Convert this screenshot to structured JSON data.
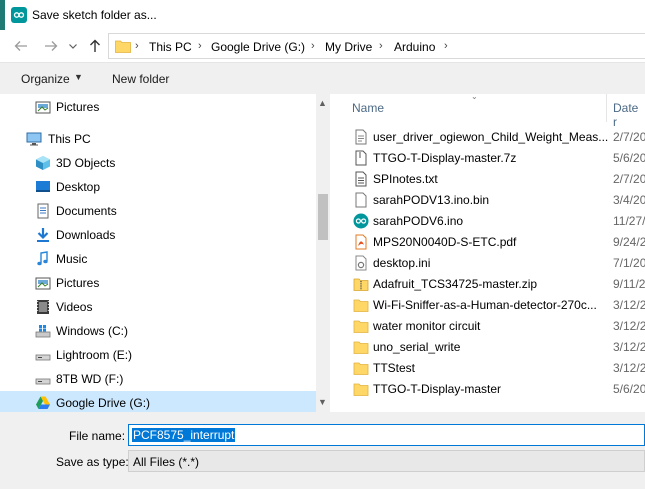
{
  "window": {
    "title": "Save sketch folder as...",
    "accent": "#1f7a74"
  },
  "nav": {
    "back_icon": "arrow-left-icon",
    "forward_icon": "arrow-right-icon",
    "recent_icon": "chevron-down-icon",
    "up_icon": "arrow-up-icon"
  },
  "breadcrumb": [
    "This PC",
    "Google Drive (G:)",
    "My Drive",
    "Arduino"
  ],
  "toolbar": {
    "organize": "Organize",
    "new_folder": "New folder"
  },
  "navpane": {
    "items": [
      {
        "label": "Pictures",
        "icon": "pictures-icon"
      },
      {
        "label": "This PC",
        "icon": "computer-icon"
      },
      {
        "label": "3D Objects",
        "icon": "3d-objects-icon"
      },
      {
        "label": "Desktop",
        "icon": "desktop-icon"
      },
      {
        "label": "Documents",
        "icon": "documents-icon"
      },
      {
        "label": "Downloads",
        "icon": "downloads-icon"
      },
      {
        "label": "Music",
        "icon": "music-icon"
      },
      {
        "label": "Pictures",
        "icon": "pictures-icon"
      },
      {
        "label": "Videos",
        "icon": "videos-icon"
      },
      {
        "label": "Windows (C:)",
        "icon": "windows-drive-icon"
      },
      {
        "label": "Lightroom (E:)",
        "icon": "drive-icon"
      },
      {
        "label": "8TB WD (F:)",
        "icon": "drive-icon"
      },
      {
        "label": "Google Drive (G:)",
        "icon": "google-drive-icon"
      }
    ]
  },
  "filelist": {
    "columns": {
      "name": "Name",
      "date": "Date r"
    },
    "files": [
      {
        "name": "user_driver_ogiewon_Child_Weight_Meas...",
        "date": "2/7/20",
        "icon": "text-file-icon"
      },
      {
        "name": "TTGO-T-Display-master.7z",
        "date": "5/6/20",
        "icon": "archive-file-icon"
      },
      {
        "name": "SPInotes.txt",
        "date": "2/7/20",
        "icon": "text-file-icon"
      },
      {
        "name": "sarahPODV13.ino.bin",
        "date": "3/4/20",
        "icon": "file-icon"
      },
      {
        "name": "sarahPODV6.ino",
        "date": "11/27/",
        "icon": "arduino-file-icon"
      },
      {
        "name": "MPS20N0040D-S-ETC.pdf",
        "date": "9/24/2",
        "icon": "pdf-file-icon"
      },
      {
        "name": "desktop.ini",
        "date": "7/1/20",
        "icon": "settings-file-icon"
      },
      {
        "name": "Adafruit_TCS34725-master.zip",
        "date": "9/11/2",
        "icon": "zip-file-icon"
      },
      {
        "name": "Wi-Fi-Sniffer-as-a-Human-detector-270c...",
        "date": "3/12/2",
        "icon": "folder-icon"
      },
      {
        "name": "water monitor circuit",
        "date": "3/12/2",
        "icon": "folder-icon"
      },
      {
        "name": "uno_serial_write",
        "date": "3/12/2",
        "icon": "folder-icon"
      },
      {
        "name": "TTStest",
        "date": "3/12/2",
        "icon": "folder-icon"
      },
      {
        "name": "TTGO-T-Display-master",
        "date": "5/6/20",
        "icon": "folder-icon"
      }
    ]
  },
  "bottom": {
    "file_name_label": "File name:",
    "file_name_value": "PCF8575_interrupt",
    "save_as_type_label": "Save as type:",
    "save_as_type_value": "All Files (*.*)"
  }
}
